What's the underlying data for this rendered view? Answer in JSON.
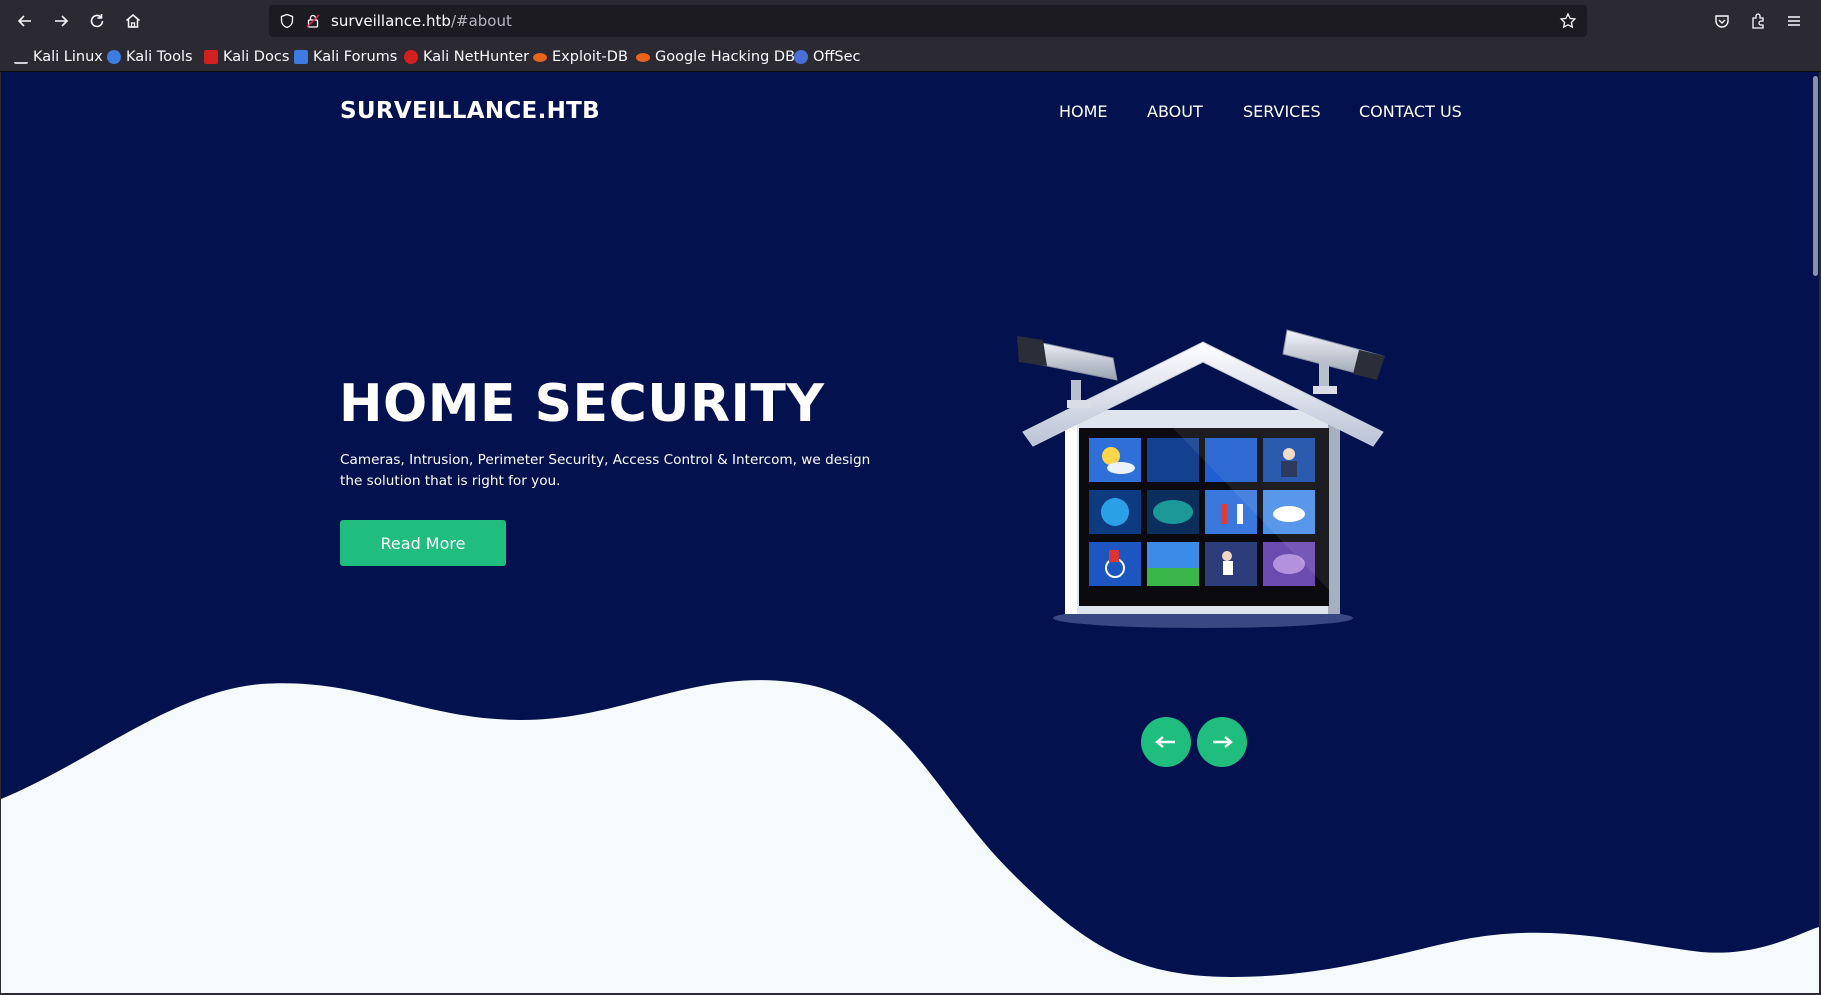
{
  "browser": {
    "url_host": "surveillance.htb",
    "url_path": "/#about",
    "bookmarks": [
      {
        "label": "Kali Linux",
        "color": "#3a3a3a"
      },
      {
        "label": "Kali Tools",
        "color": "#3d7be0"
      },
      {
        "label": "Kali Docs",
        "color": "#d21f1f"
      },
      {
        "label": "Kali Forums",
        "color": "#3d7be0"
      },
      {
        "label": "Kali NetHunter",
        "color": "#d21f1f"
      },
      {
        "label": "Exploit-DB",
        "color": "#e8641b"
      },
      {
        "label": "Google Hacking DB",
        "color": "#e8641b"
      },
      {
        "label": "OffSec",
        "color": "#4a6fd6"
      }
    ]
  },
  "site": {
    "brand": "SURVEILLANCE.HTB",
    "nav": [
      "HOME",
      "ABOUT",
      "SERVICES",
      "CONTACT US"
    ]
  },
  "hero": {
    "title": "HOME SECURITY",
    "text": "Cameras, Intrusion, Perimeter Security, Access Control & Intercom, we design the solution that is right for you.",
    "button": "Read More"
  },
  "colors": {
    "hero_bg": "#03124f",
    "accent": "#1fbd7e",
    "wave": "#f5fafc"
  },
  "icons": {
    "back": "arrow-left-icon",
    "forward": "arrow-right-icon",
    "reload": "reload-icon",
    "home": "home-icon",
    "prev_slide": "arrow-left-icon",
    "next_slide": "arrow-right-icon"
  }
}
